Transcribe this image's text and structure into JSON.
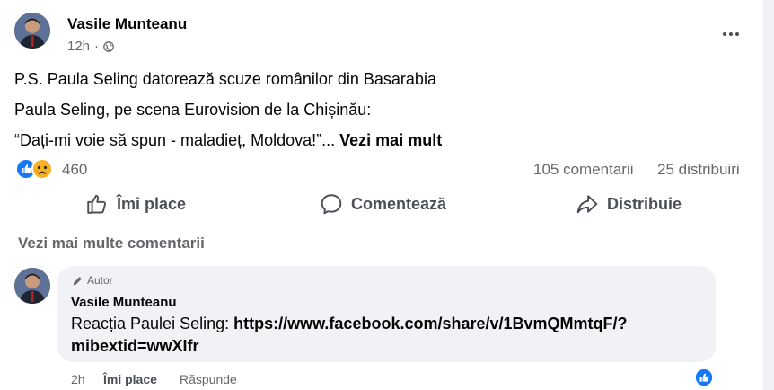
{
  "post": {
    "author": "Vasile Munteanu",
    "time": "12h",
    "privacy_icon": "globe-icon",
    "lines": [
      "P.S. Paula Seling datorează scuze românilor din Basarabia",
      "Paula Seling, pe scena Eurovision de la Chișinău:",
      "“Dați-mi voie să spun - maladieț, Moldova!”..."
    ],
    "see_more": "Vezi mai mult"
  },
  "stats": {
    "reactions": "460",
    "reaction_icons": [
      "like-icon",
      "sad-icon"
    ],
    "comments": "105 comentarii",
    "shares": "25 distribuiri"
  },
  "actions": {
    "like": "Îmi place",
    "comment": "Comentează",
    "share": "Distribuie"
  },
  "view_more_comments": "Vezi mai multe comentarii",
  "comment": {
    "tag": "Autor",
    "author": "Vasile Munteanu",
    "text": "Reacția Paulei Seling: ",
    "link": "https://www.facebook.com/share/v/1BvmQMmtqF/?mibextid=wwXIfr",
    "time": "2h",
    "like": "Îmi place",
    "reply": "Răspunde"
  },
  "colors": {
    "like_blue": "#1877f2",
    "sad_yellow": "#f7b125",
    "secondary_text": "#65676b",
    "bubble_bg": "#f0f2f5"
  }
}
